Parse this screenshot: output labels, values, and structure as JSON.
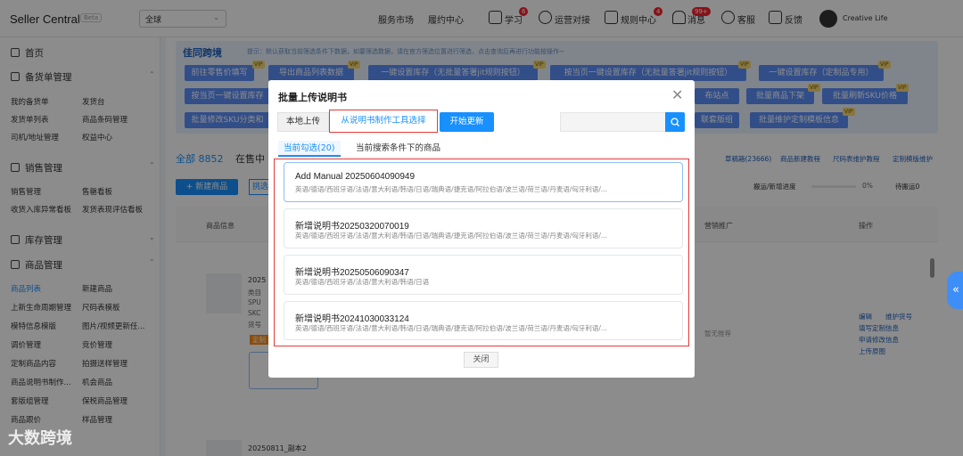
{
  "header": {
    "app_title": "Seller Central",
    "beta": "Beta",
    "region": "全球",
    "nav": [
      "服务市场",
      "履约中心"
    ],
    "study": "学习",
    "study_badge": "6",
    "ops": "运营对接",
    "rules": "规则中心",
    "rules_badge": "4",
    "messages": "消息",
    "messages_badge": "99+",
    "service": "客服",
    "feedback": "反馈",
    "user": "Creative Life"
  },
  "sidebar": {
    "home": "首页",
    "sections": [
      {
        "title": "备货单管理",
        "items": [
          "我的备货单",
          "发货台",
          "发货单列表",
          "商品条码管理",
          "司机/地址管理",
          "权益中心"
        ]
      },
      {
        "title": "销售管理",
        "items": [
          "销售管理",
          "售罄看板",
          "收货入库异常看板",
          "发货表现评估看板"
        ]
      },
      {
        "title": "库存管理",
        "items": []
      },
      {
        "title": "商品管理",
        "items": [
          "商品列表",
          "新建商品",
          "上新生命周期管理",
          "尺码表模板",
          "模特信息模版",
          "图片/视频更新任...",
          "调价管理",
          "竞价管理",
          "定制商品内容",
          "拍摄送样管理",
          "商品说明书制作...",
          "机会商品",
          "套版组管理",
          "保税商品管理",
          "商品跟价",
          "样品管理"
        ]
      }
    ]
  },
  "background": {
    "tip_logo": "佳同跨境",
    "tip_text": "提示：默认获取当前筛选条件下数据，如要筛选数据，请在官方筛选位置进行筛选，点击查询后再进行功能按操作~",
    "buttons_row1": [
      "前往零售价填写",
      "导出商品列表数据",
      "一键设置库存（无批量答署jit规则按钮）",
      "按当页一键设置库存（无批量答署jit规则按钮）",
      "一键设置库存（定制品专用）"
    ],
    "buttons_row2": [
      "按当页一键设置库存",
      "布站点",
      "批量商品下架",
      "批量刷新SKU价格"
    ],
    "buttons_row3": [
      "批量修改SKU分类和",
      "联套版组",
      "批量维护定制模板信息"
    ],
    "vip": "VIP",
    "tab_all": "全部 8852",
    "tab_onsale": "在售中",
    "new_product": "+ 新建商品",
    "filter": "挑选",
    "links": [
      "草稿箱(23666)",
      "商品新建教程",
      "尺码表维护教程",
      "定制模版维护"
    ],
    "progress_label": "搬运/新增进度",
    "progress": "0%",
    "pending": "待搬运0",
    "col_product": "商品信息",
    "col_marketing": "营销推广",
    "col_ops": "操作",
    "row_product": "2025",
    "row_meta": [
      "类目",
      "SPU",
      "SKC",
      "货号"
    ],
    "row_tag": "定制",
    "row_actions": [
      "编辑",
      "维护货号",
      "填写定制信息",
      "申请修改信息",
      "上传原图"
    ],
    "no_promo": "暂无推荐",
    "row2_product": "20250811_副本2",
    "watermark": "大数跨境"
  },
  "modal": {
    "title": "批量上传说明书",
    "btn_local": "本地上传",
    "btn_tool": "从说明书制作工具选择",
    "btn_update": "开始更新",
    "search_placeholder": "",
    "tabs": [
      "当前勾选(20)",
      "当前搜索条件下的商品"
    ],
    "cards": [
      {
        "title": "Add Manual 20250604090949",
        "langs": "英语/德语/西班牙语/法语/意大利语/韩语/日语/瑞典语/捷克语/阿拉伯语/波兰语/荷兰语/丹麦语/匈牙利语/..."
      },
      {
        "title": "新增说明书20250320070019",
        "langs": "英语/德语/西班牙语/法语/意大利语/韩语/日语/瑞典语/捷克语/阿拉伯语/波兰语/荷兰语/丹麦语/匈牙利语/..."
      },
      {
        "title": "新增说明书20250506090347",
        "langs": "英语/德语/西班牙语/法语/意大利语/韩语/日语"
      },
      {
        "title": "新增说明书20241030033124",
        "langs": "英语/德语/西班牙语/法语/意大利语/韩语/日语/瑞典语/捷克语/阿拉伯语/波兰语/荷兰语/丹麦语/匈牙利语/..."
      }
    ],
    "close": "关闭"
  }
}
